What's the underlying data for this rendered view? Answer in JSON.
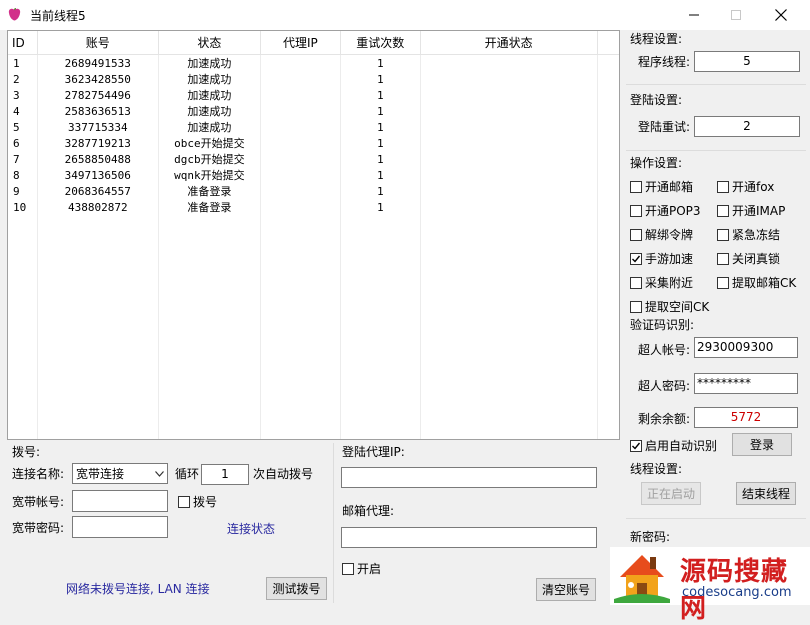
{
  "window": {
    "title": "当前线程5"
  },
  "table": {
    "columns": [
      "ID",
      "账号",
      "状态",
      "代理IP",
      "重试次数",
      "开通状态"
    ],
    "rows": [
      [
        "1",
        "2689491533",
        "加速成功",
        "",
        "1",
        ""
      ],
      [
        "2",
        "3623428550",
        "加速成功",
        "",
        "1",
        ""
      ],
      [
        "3",
        "2782754496",
        "加速成功",
        "",
        "1",
        ""
      ],
      [
        "4",
        "2583636513",
        "加速成功",
        "",
        "1",
        ""
      ],
      [
        "5",
        "337715334",
        "加速成功",
        "",
        "1",
        ""
      ],
      [
        "6",
        "3287719213",
        "obce开始提交",
        "",
        "1",
        ""
      ],
      [
        "7",
        "2658850488",
        "dgcb开始提交",
        "",
        "1",
        ""
      ],
      [
        "8",
        "3497136506",
        "wqnk开始提交",
        "",
        "1",
        ""
      ],
      [
        "9",
        "2068364557",
        "准备登录",
        "",
        "1",
        ""
      ],
      [
        "10",
        "438802872",
        "准备登录",
        "",
        "1",
        ""
      ]
    ]
  },
  "dial": {
    "group": "拨号:",
    "conn_label": "连接名称:",
    "conn_value": "宽带连接",
    "cycle_label": "循环",
    "cycle_value": "1",
    "auto_label": "次自动拨号",
    "account_label": "宽带帐号:",
    "account_value": "",
    "dial_chk": "拨号",
    "password_label": "宽带密码:",
    "password_value": "",
    "conn_status_link": "连接状态",
    "net_status": "网络未拨号连接, LAN 连接",
    "test_btn": "测试拨号"
  },
  "proxy": {
    "login_proxy_label": "登陆代理IP:",
    "login_proxy_value": "",
    "mail_proxy_label": "邮箱代理:",
    "mail_proxy_value": "",
    "enable_chk": "开启",
    "clear_btn": "清空账号"
  },
  "settings": {
    "thread_group": "线程设置:",
    "thread_label": "程序线程:",
    "thread_value": "5",
    "login_group": "登陆设置:",
    "retry_label": "登陆重试:",
    "retry_value": "2",
    "ops_group": "操作设置:",
    "ops": [
      {
        "label": "开通邮箱",
        "checked": false
      },
      {
        "label": "开通fox",
        "checked": false
      },
      {
        "label": "开通POP3",
        "checked": false
      },
      {
        "label": "开通IMAP",
        "checked": false
      },
      {
        "label": "解绑令牌",
        "checked": false
      },
      {
        "label": "紧急冻结",
        "checked": false
      },
      {
        "label": "手游加速",
        "checked": true
      },
      {
        "label": "关闭真锁",
        "checked": false
      },
      {
        "label": "采集附近",
        "checked": false
      },
      {
        "label": "提取邮箱CK",
        "checked": false
      },
      {
        "label": "提取空间CK",
        "checked": false
      }
    ],
    "captcha_group": "验证码识别:",
    "super_account_label": "超人帐号:",
    "super_account_value": "2930009300",
    "super_password_label": "超人密码:",
    "super_password_value": "*********",
    "balance_label": "剩余余额:",
    "balance_value": "5772",
    "auto_recog_chk": "启用自动识别",
    "auto_recog_checked": true,
    "login_btn": "登录",
    "thread_group2": "线程设置:",
    "starting_btn": "正在启动",
    "end_btn": "结束线程",
    "new_password_group": "新密码:"
  },
  "watermark": {
    "main": "源码搜藏网",
    "sub": "codesocang.com"
  },
  "colors": {
    "balance": "#cc0000",
    "link": "#2a2aa0",
    "watermark_red": "#d21f1f",
    "watermark_blue": "#1a3e8a"
  }
}
